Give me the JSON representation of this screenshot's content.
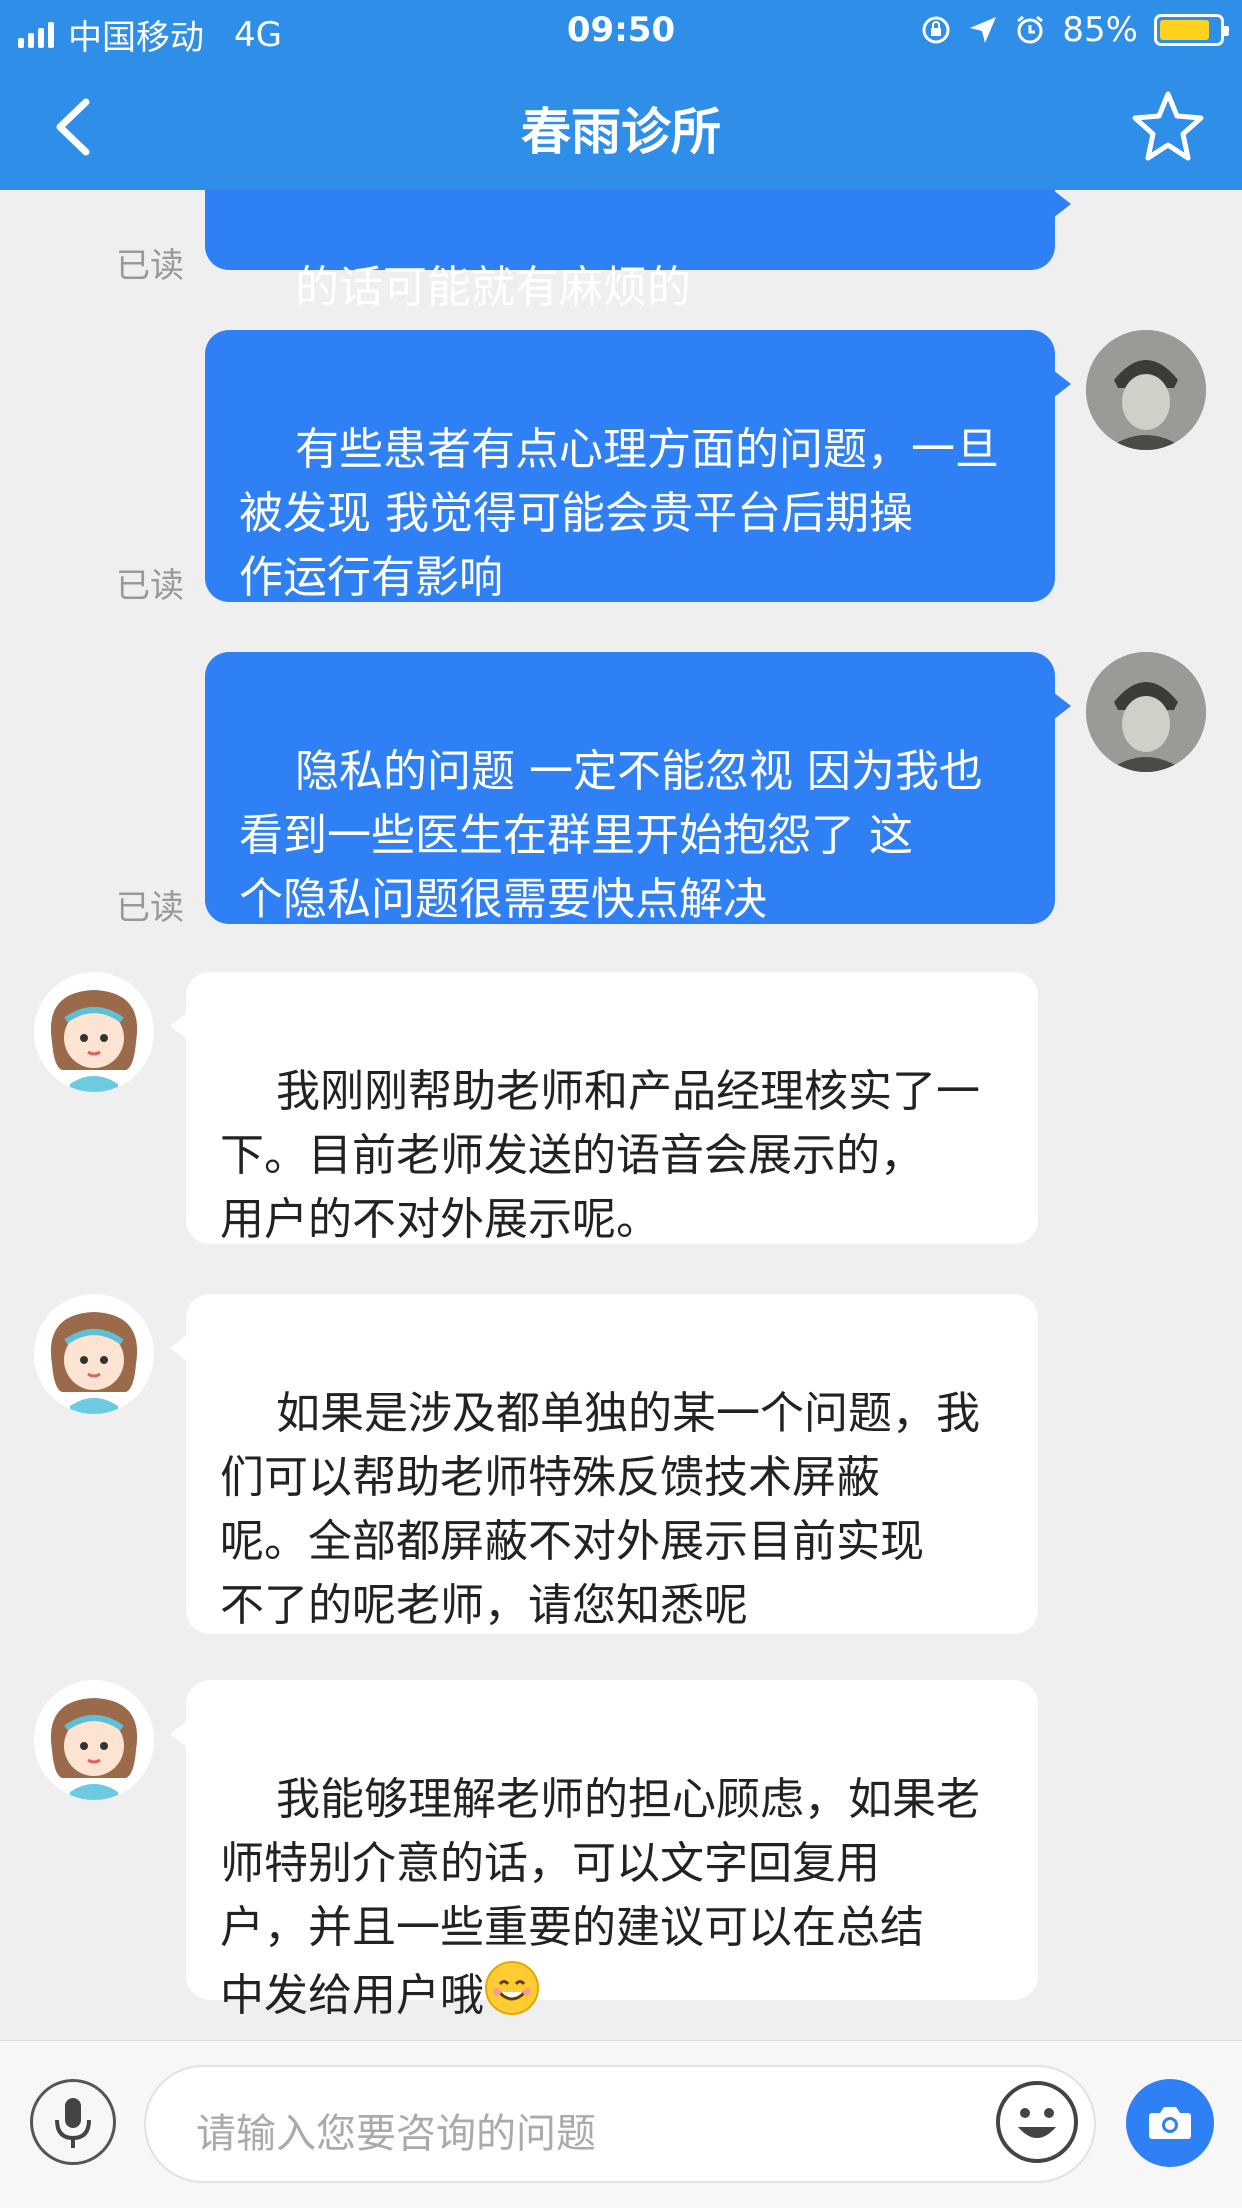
{
  "status_bar": {
    "carrier": "中国移动",
    "network": "4G",
    "time": "09:50",
    "battery": "85%"
  },
  "navbar": {
    "title": "春雨诊所"
  },
  "messages": [
    {
      "side": "out",
      "text": "的话可能就有麻烦的",
      "read": "已读"
    },
    {
      "side": "out",
      "text": "有些患者有点心理方面的问题，一旦\n被发现 我觉得可能会贵平台后期操\n作运行有影响",
      "read": "已读"
    },
    {
      "side": "out",
      "text": "隐私的问题 一定不能忽视 因为我也\n看到一些医生在群里开始抱怨了 这\n个隐私问题很需要快点解决",
      "read": "已读"
    },
    {
      "side": "in",
      "text": "我刚刚帮助老师和产品经理核实了一\n下。目前老师发送的语音会展示的，\n用户的不对外展示呢。"
    },
    {
      "side": "in",
      "text": "如果是涉及都单独的某一个问题，我\n们可以帮助老师特殊反馈技术屏蔽\n呢。全部都屏蔽不对外展示目前实现\n不了的呢老师，请您知悉呢"
    },
    {
      "side": "in",
      "text": "我能够理解老师的担心顾虑，如果老\n师特别介意的话，可以文字回复用\n户，并且一些重要的建议可以在总结\n中发给用户哦"
    }
  ],
  "input": {
    "placeholder": "请输入您要咨询的问题"
  },
  "colors": {
    "brand_blue": "#2f8ee8",
    "outgoing_bubble": "#2f7ff5",
    "battery_fill": "#ffd21f"
  },
  "icons": [
    "back-chevron-icon",
    "star-icon",
    "mic-icon",
    "smiley-icon",
    "camera-icon",
    "location-arrow-icon",
    "alarm-icon",
    "orientation-lock-icon"
  ]
}
